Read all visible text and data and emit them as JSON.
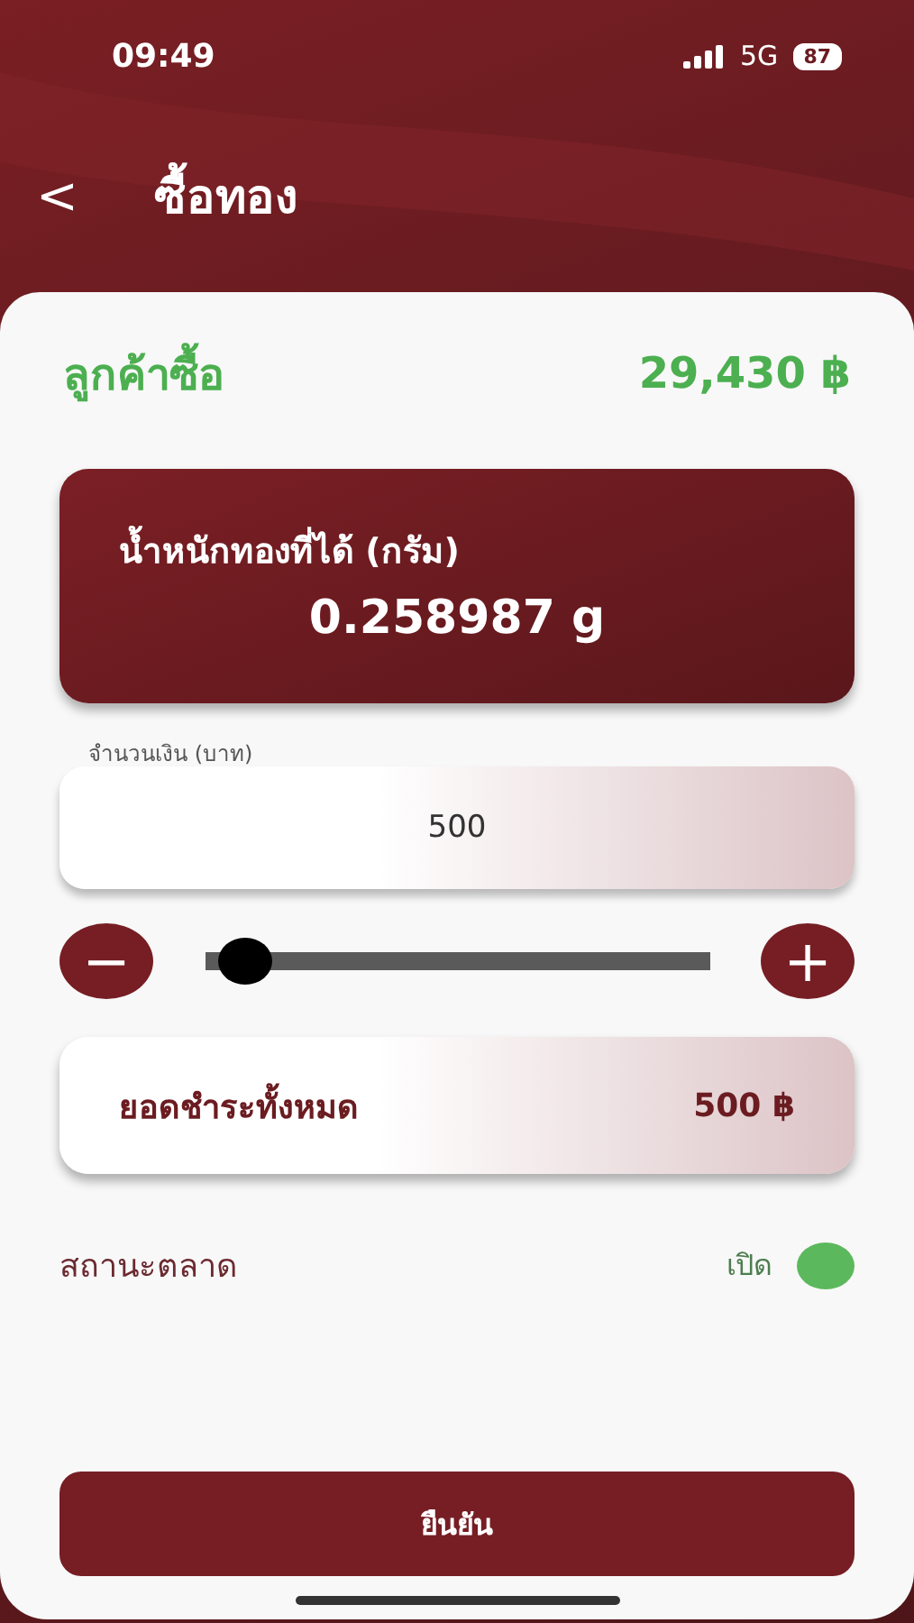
{
  "status_bar": {
    "time": "09:49",
    "network": "5G",
    "battery": "87"
  },
  "header": {
    "back": "<",
    "title": "ซื้อทอง"
  },
  "summary": {
    "label": "ลูกค้าซื้อ",
    "amount": "29,430 ฿"
  },
  "weight_card": {
    "label": "น้ำหนักทองที่ได้ (กรัม)",
    "value": "0.258987 g"
  },
  "amount_field": {
    "label": "จำนวนเงิน (บาท)",
    "value": "500"
  },
  "stepper": {
    "minus": "−",
    "plus": "+",
    "level": 0.03
  },
  "total_card": {
    "label": "ยอดชำระทั้งหมด",
    "value": "500 ฿"
  },
  "market_status": {
    "label": "สถานะตลาด",
    "value": "เปิด",
    "open": true
  },
  "confirm_button": "ยืนยัน"
}
